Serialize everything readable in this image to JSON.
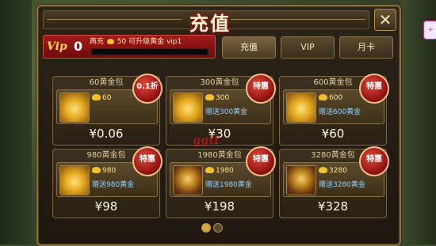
{
  "dialog": {
    "title": "充值",
    "close_label": "✕"
  },
  "vip": {
    "badge": "Vip",
    "level": "0",
    "info_prefix": "再充",
    "info_amount": "50",
    "info_suffix": "可升级黄金 vip1"
  },
  "tabs": [
    {
      "label": "充值",
      "active": true
    },
    {
      "label": "VIP",
      "active": false
    },
    {
      "label": "月卡",
      "active": false
    }
  ],
  "packages": [
    {
      "name": "60黄金包",
      "amount": "60",
      "bonus": "",
      "price": "¥0.06",
      "ribbon": "0.1折",
      "icon": "gold-ingot-small-icon"
    },
    {
      "name": "300黄金包",
      "amount": "300",
      "bonus": "赠送300黄金",
      "price": "¥30",
      "ribbon": "特惠",
      "icon": "gold-ingot-pile-icon"
    },
    {
      "name": "600黄金包",
      "amount": "600",
      "bonus": "赠送600黄金",
      "price": "¥60",
      "ribbon": "特惠",
      "icon": "gold-ingot-pile-icon"
    },
    {
      "name": "980黄金包",
      "amount": "980",
      "bonus": "赠送980黄金",
      "price": "¥98",
      "ribbon": "特惠",
      "icon": "gold-ingot-heap-icon"
    },
    {
      "name": "1980黄金包",
      "amount": "1980",
      "bonus": "赠送1980黄金",
      "price": "¥198",
      "ribbon": "特惠",
      "icon": "treasure-bag-icon"
    },
    {
      "name": "3280黄金包",
      "amount": "3280",
      "bonus": "赠送3280黄金",
      "price": "¥328",
      "ribbon": "特惠",
      "icon": "treasure-chest-icon"
    }
  ],
  "pagination": {
    "pages": 2,
    "current": 1
  },
  "watermark": "ggtf",
  "side_badge": "+",
  "colors": {
    "accent_gold": "#d9a63a",
    "ribbon_red": "#8c0f0f",
    "bonus_blue": "#8fd0ff"
  }
}
